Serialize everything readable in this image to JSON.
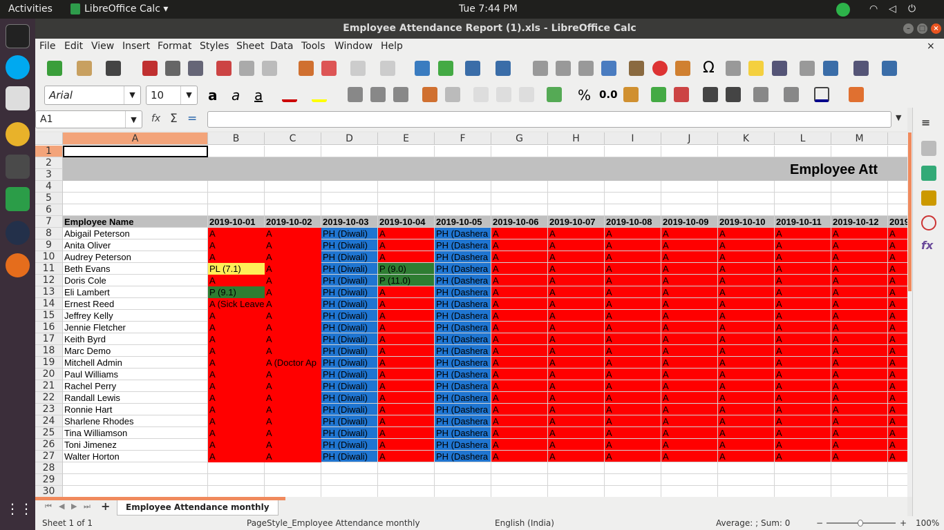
{
  "topbar": {
    "activities": "Activities",
    "app": "LibreOffice Calc ▾",
    "clock": "Tue  7:44 PM"
  },
  "window": {
    "title": "Employee Attendance Report (1).xls - LibreOffice Calc"
  },
  "menu": [
    "File",
    "Edit",
    "View",
    "Insert",
    "Format",
    "Styles",
    "Sheet",
    "Data",
    "Tools",
    "Window",
    "Help"
  ],
  "format": {
    "font": "Arial",
    "size": "10",
    "pct": "%",
    "dec": "0.0"
  },
  "formula": {
    "namebox": "A1",
    "fx": "fx",
    "sigma": "Σ",
    "eq": "="
  },
  "columns": [
    "A",
    "B",
    "C",
    "D",
    "E",
    "F",
    "G",
    "H",
    "I",
    "J",
    "K",
    "L",
    "M"
  ],
  "title_text": "Employee Att",
  "header_row": [
    "Employee Name",
    "2019-10-01",
    "2019-10-02",
    "2019-10-03",
    "2019-10-04",
    "2019-10-05",
    "2019-10-06",
    "2019-10-07",
    "2019-10-08",
    "2019-10-09",
    "2019-10-10",
    "2019-10-11",
    "2019-10-12",
    "2019"
  ],
  "employees": [
    {
      "name": "Abigail Peterson",
      "b": "A",
      "c": "A",
      "e": "A"
    },
    {
      "name": "Anita Oliver",
      "b": "A",
      "c": "A",
      "e": "A"
    },
    {
      "name": "Audrey Peterson",
      "b": "A",
      "c": "A",
      "e": "A"
    },
    {
      "name": "Beth Evans",
      "b": "PL (7.1)",
      "c": "A",
      "e": "P (9.0)"
    },
    {
      "name": "Doris Cole",
      "b": "A",
      "c": "A",
      "e": "P (11.0)"
    },
    {
      "name": "Eli Lambert",
      "b": "P (9.1)",
      "c": "A",
      "e": "A"
    },
    {
      "name": "Ernest Reed",
      "b": "A (Sick Leave",
      "c": "A",
      "e": "A"
    },
    {
      "name": "Jeffrey Kelly",
      "b": "A",
      "c": "A",
      "e": "A"
    },
    {
      "name": "Jennie Fletcher",
      "b": "A",
      "c": "A",
      "e": "A"
    },
    {
      "name": "Keith Byrd",
      "b": "A",
      "c": "A",
      "e": "A"
    },
    {
      "name": "Marc Demo",
      "b": "A",
      "c": "A",
      "e": "A"
    },
    {
      "name": "Mitchell Admin",
      "b": "A",
      "c": "A (Doctor Ap",
      "e": "A"
    },
    {
      "name": "Paul Williams",
      "b": "A",
      "c": "A",
      "e": "A"
    },
    {
      "name": "Rachel Perry",
      "b": "A",
      "c": "A",
      "e": "A"
    },
    {
      "name": "Randall Lewis",
      "b": "A",
      "c": "A",
      "e": "A"
    },
    {
      "name": "Ronnie Hart",
      "b": "A",
      "c": "A",
      "e": "A"
    },
    {
      "name": "Sharlene Rhodes",
      "b": "A",
      "c": "A",
      "e": "A"
    },
    {
      "name": "Tina Williamson",
      "b": "A",
      "c": "A",
      "e": "A"
    },
    {
      "name": "Toni Jimenez",
      "b": "A",
      "c": "A",
      "e": "A"
    },
    {
      "name": "Walter Horton",
      "b": "A",
      "c": "A",
      "e": "A"
    }
  ],
  "values": {
    "absent": "A",
    "diwali": "PH (Diwali)",
    "dasherah": "PH (Dashera"
  },
  "colors": {
    "absent": "#ff0000",
    "holiday": "#1f75d1",
    "present": "#2e7d32",
    "paid_leave": "#ffee58",
    "header_gray": "#c0c0c0",
    "accent": "#f08a5d"
  },
  "row_numbers": [
    "1",
    "2",
    "3",
    "4",
    "5",
    "6",
    "7",
    "8",
    "9",
    "10",
    "11",
    "12",
    "13",
    "14",
    "15",
    "16",
    "17",
    "18",
    "19",
    "20",
    "21",
    "22",
    "23",
    "24",
    "25",
    "26",
    "27",
    "28",
    "29",
    "30"
  ],
  "sheet_tab": "Employee Attendance monthly",
  "status": {
    "sheet": "Sheet 1 of 1",
    "style": "PageStyle_Employee Attendance monthly",
    "lang": "English (India)",
    "sum": "Average: ; Sum: 0",
    "zoom": "100%"
  }
}
